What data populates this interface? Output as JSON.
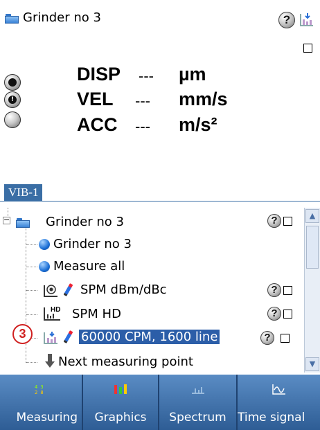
{
  "header": {
    "title": "Grinder no 3",
    "help_symbol": "?"
  },
  "measurements": [
    {
      "label": "DISP",
      "value": "---",
      "unit": "µm",
      "indicator_symbol": ""
    },
    {
      "label": "VEL",
      "value": "---",
      "unit": "mm/s",
      "indicator_symbol": "!"
    },
    {
      "label": "ACC",
      "value": "---",
      "unit": "m/s²",
      "indicator_symbol": ""
    }
  ],
  "channel_tag": "VIB-1",
  "tree": {
    "root": {
      "label": "Grinder no 3",
      "expander": "−"
    },
    "items": [
      {
        "label": "Grinder no 3"
      },
      {
        "label": "Measure all"
      },
      {
        "label": "SPM dBm/dBc"
      },
      {
        "label": "SPM HD"
      },
      {
        "label": "60000 CPM, 1600 line",
        "selected": true
      },
      {
        "label": "Next measuring point"
      }
    ],
    "icons": {
      "spm_hd": "HD"
    }
  },
  "step_marker": "3",
  "toolbar": {
    "buttons": [
      {
        "label": "Measuring"
      },
      {
        "label": "Graphics"
      },
      {
        "label": "Spectrum"
      },
      {
        "label": "Time signal"
      }
    ]
  },
  "colors": {
    "selection": "#2c5ea8",
    "toolbar": "#3d6fa6",
    "step_marker": "#d02020"
  }
}
